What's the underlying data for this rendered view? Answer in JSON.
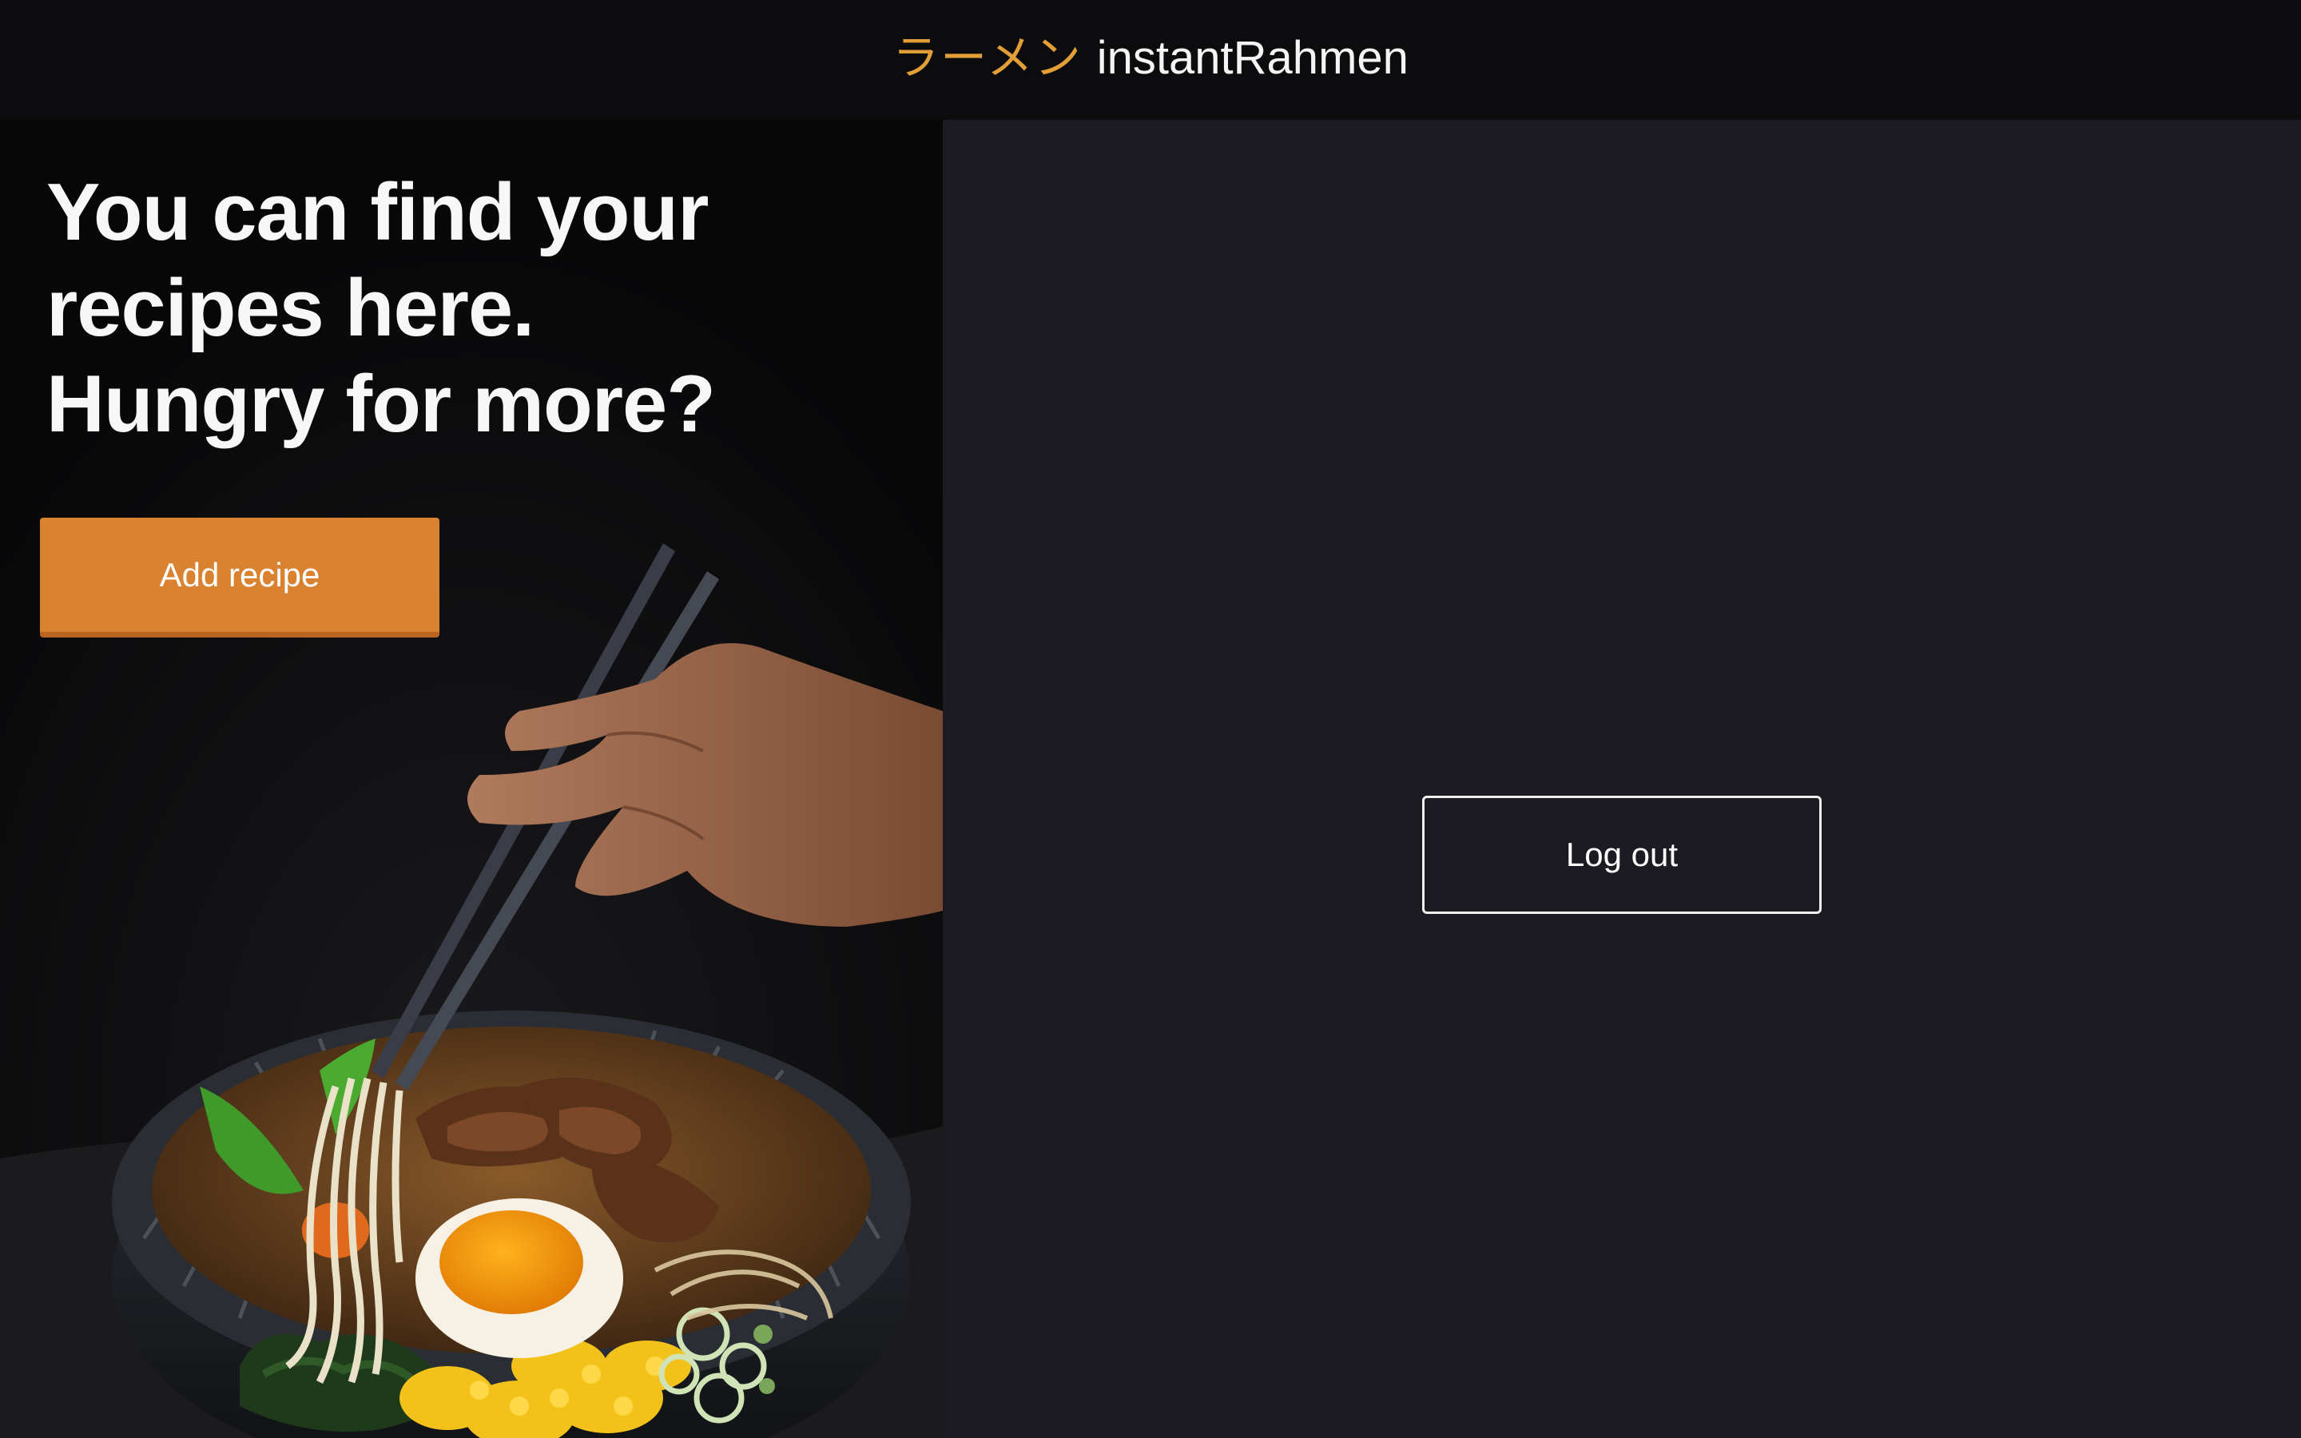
{
  "header": {
    "brand_jp": "ラーメン",
    "brand_name": "instantRahmen"
  },
  "hero": {
    "headline_lines": [
      "You can find your",
      "recipes here.",
      "Hungry for more?"
    ],
    "add_recipe_label": "Add recipe",
    "image": "ramen-bowl-with-chopsticks-photo"
  },
  "account": {
    "logout_label": "Log out"
  },
  "colors": {
    "accent": "#d9822f",
    "brand_jp": "#e29f37",
    "topbar_bg": "#0c0c0f",
    "panel_bg": "#1c1b23"
  }
}
